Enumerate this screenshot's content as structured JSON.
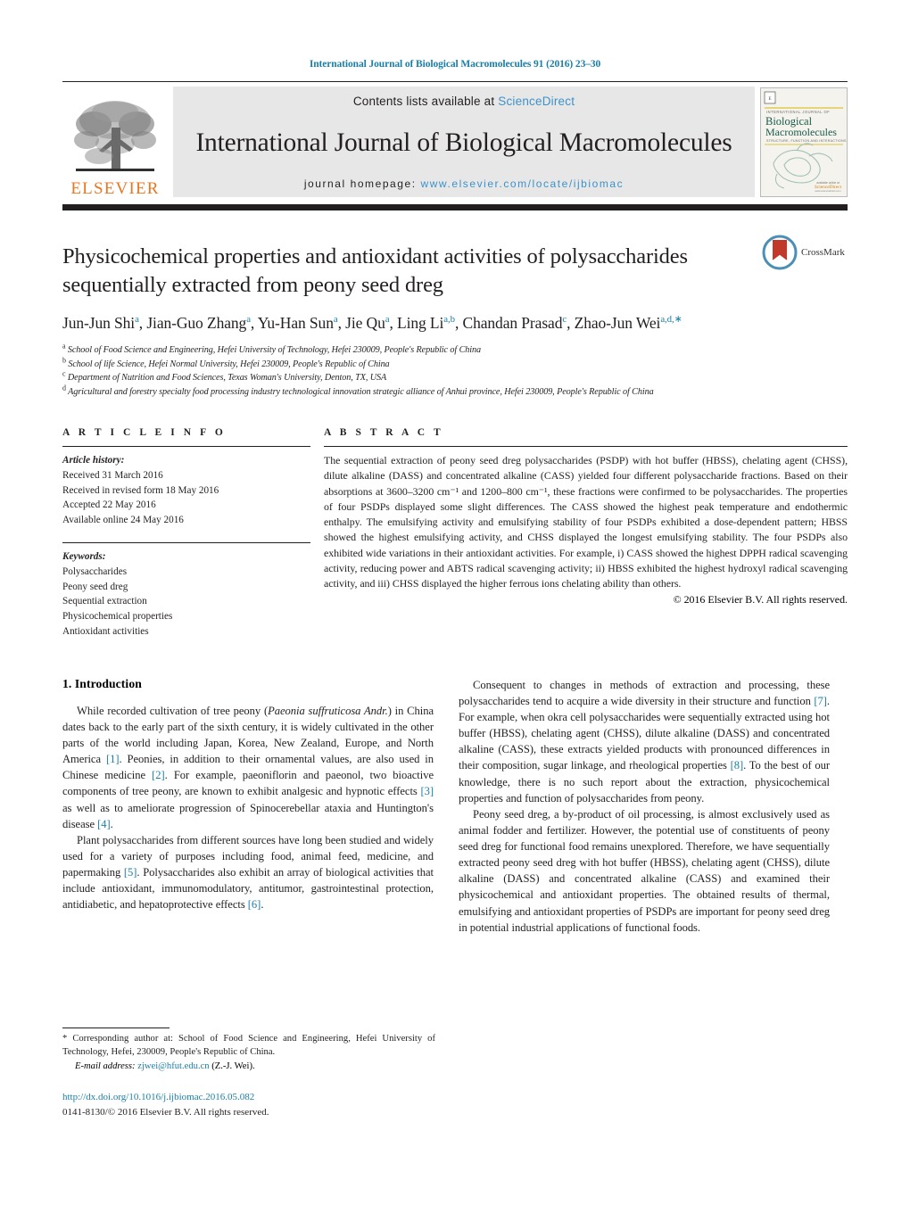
{
  "running_head": "International Journal of Biological Macromolecules 91 (2016) 23–30",
  "masthead": {
    "publisher_name": "ELSEVIER",
    "contents_prefix": "Contents lists available at ",
    "contents_link": "ScienceDirect",
    "journal_title": "International Journal of Biological Macromolecules",
    "homepage_prefix": "journal homepage: ",
    "homepage_url": "www.elsevier.com/locate/ijbiomac",
    "cover": {
      "line1": "INTERNATIONAL JOURNAL OF",
      "line2": "Biological",
      "line3": "Macromolecules",
      "line4": "STRUCTURE, FUNCTION AND INTERACTIONS",
      "footer": "ScienceDirect",
      "footer_sub": "www.sciencedirect.com"
    }
  },
  "article": {
    "title": "Physicochemical properties and antioxidant activities of polysaccharides sequentially extracted from peony seed dreg",
    "crossmark_label": "CrossMark",
    "authors_html": "Jun-Jun Shi<sup>a</sup>, Jian-Guo Zhang<sup>a</sup>, Yu-Han Sun<sup>a</sup>, Jie Qu<sup>a</sup>, Ling Li<sup>a,b</sup>, Chandan Prasad<sup>c</sup>, Zhao-Jun Wei<sup>a,d,∗</sup>",
    "affiliations": [
      {
        "marker": "a",
        "text": "School of Food Science and Engineering, Hefei University of Technology, Hefei 230009, People's Republic of China"
      },
      {
        "marker": "b",
        "text": "School of life Science, Hefei Normal University, Hefei 230009, People's Republic of China"
      },
      {
        "marker": "c",
        "text": "Department of Nutrition and Food Sciences, Texas Woman's University, Denton, TX, USA"
      },
      {
        "marker": "d",
        "text": "Agricultural and forestry specialty food processing industry technological innovation strategic alliance of Anhui province, Hefei 230009, People's Republic of China"
      }
    ]
  },
  "article_info": {
    "heading": "A R T I C L E   I N F O",
    "history_label": "Article history:",
    "history": [
      "Received 31 March 2016",
      "Received in revised form 18 May 2016",
      "Accepted 22 May 2016",
      "Available online 24 May 2016"
    ],
    "keywords_label": "Keywords:",
    "keywords": [
      "Polysaccharides",
      "Peony seed dreg",
      "Sequential extraction",
      "Physicochemical properties",
      "Antioxidant activities"
    ]
  },
  "abstract": {
    "heading": "A B S T R A C T",
    "text": "The sequential extraction of peony seed dreg polysaccharides (PSDP) with hot buffer (HBSS), chelating agent (CHSS), dilute alkaline (DASS) and concentrated alkaline (CASS) yielded four different polysaccharide fractions. Based on their absorptions at 3600–3200 cm⁻¹ and 1200–800 cm⁻¹, these fractions were confirmed to be polysaccharides. The properties of four PSDPs displayed some slight differences. The CASS showed the highest peak temperature and endothermic enthalpy. The emulsifying activity and emulsifying stability of four PSDPs exhibited a dose-dependent pattern; HBSS showed the highest emulsifying activity, and CHSS displayed the longest emulsifying stability. The four PSDPs also exhibited wide variations in their antioxidant activities. For example, i) CASS showed the highest DPPH radical scavenging activity, reducing power and ABTS radical scavenging activity; ii) HBSS exhibited the highest hydroxyl radical scavenging activity, and iii) CHSS displayed the higher ferrous ions chelating ability than others.",
    "copyright": "© 2016 Elsevier B.V. All rights reserved."
  },
  "body": {
    "section_heading": "1.  Introduction",
    "left_paragraphs": [
      "While recorded cultivation of tree peony (<i>Paeonia suffruticosa Andr.</i>) in China dates back to the early part of the sixth century, it is widely cultivated in the other parts of the world including Japan, Korea, New Zealand, Europe, and North America <span class=\"ref\">[1]</span>. Peonies, in addition to their ornamental values, are also used in Chinese medicine <span class=\"ref\">[2]</span>. For example, paeoniflorin and paeonol, two bioactive components of tree peony, are known to exhibit analgesic and hypnotic effects <span class=\"ref\">[3]</span> as well as to ameliorate progression of Spinocerebellar ataxia and Huntington's disease <span class=\"ref\">[4]</span>.",
      "Plant polysaccharides from different sources have long been studied and widely used for a variety of purposes including food, animal feed, medicine, and papermaking <span class=\"ref\">[5]</span>. Polysaccharides also exhibit an array of biological activities that include antioxidant, immunomodulatory, antitumor, gastrointestinal protection, antidiabetic, and hepatoprotective effects <span class=\"ref\">[6]</span>."
    ],
    "right_paragraphs": [
      "Consequent to changes in methods of extraction and processing, these polysaccharides tend to acquire a wide diversity in their structure and function <span class=\"ref\">[7]</span>. For example, when okra cell polysaccharides were sequentially extracted using hot buffer (HBSS), chelating agent (CHSS), dilute alkaline (DASS) and concentrated alkaline (CASS), these extracts yielded products with pronounced differences in their composition, sugar linkage, and rheological properties <span class=\"ref\">[8]</span>. To the best of our knowledge, there is no such report about the extraction, physicochemical properties and function of polysaccharides from peony.",
      "Peony seed dreg, a by-product of oil processing, is almost exclusively used as animal fodder and fertilizer. However, the potential use of constituents of peony seed dreg for functional food remains unexplored. Therefore, we have sequentially extracted peony seed dreg with hot buffer (HBSS), chelating agent (CHSS), dilute alkaline (DASS) and concentrated alkaline (CASS) and examined their physicochemical and antioxidant properties. The obtained results of thermal, emulsifying and antioxidant properties of PSDPs are important for peony seed dreg in potential industrial applications of functional foods."
    ]
  },
  "footer": {
    "corresponding_note": "* Corresponding author at: School of Food Science and Engineering, Hefei University of Technology, Hefei, 230009, People's Republic of China.",
    "email_label": "E-mail address:",
    "email": "zjwei@hfut.edu.cn",
    "email_suffix": "(Z.-J. Wei).",
    "doi": "http://dx.doi.org/10.1016/j.ijbiomac.2016.05.082",
    "issn_line": "0141-8130/© 2016 Elsevier B.V. All rights reserved."
  },
  "colors": {
    "link": "#1a7fa8",
    "link_light": "#3d92c9",
    "elsevier_orange": "#E87722",
    "rule_dark": "#231f20",
    "box_grey": "#e7e7e7"
  }
}
